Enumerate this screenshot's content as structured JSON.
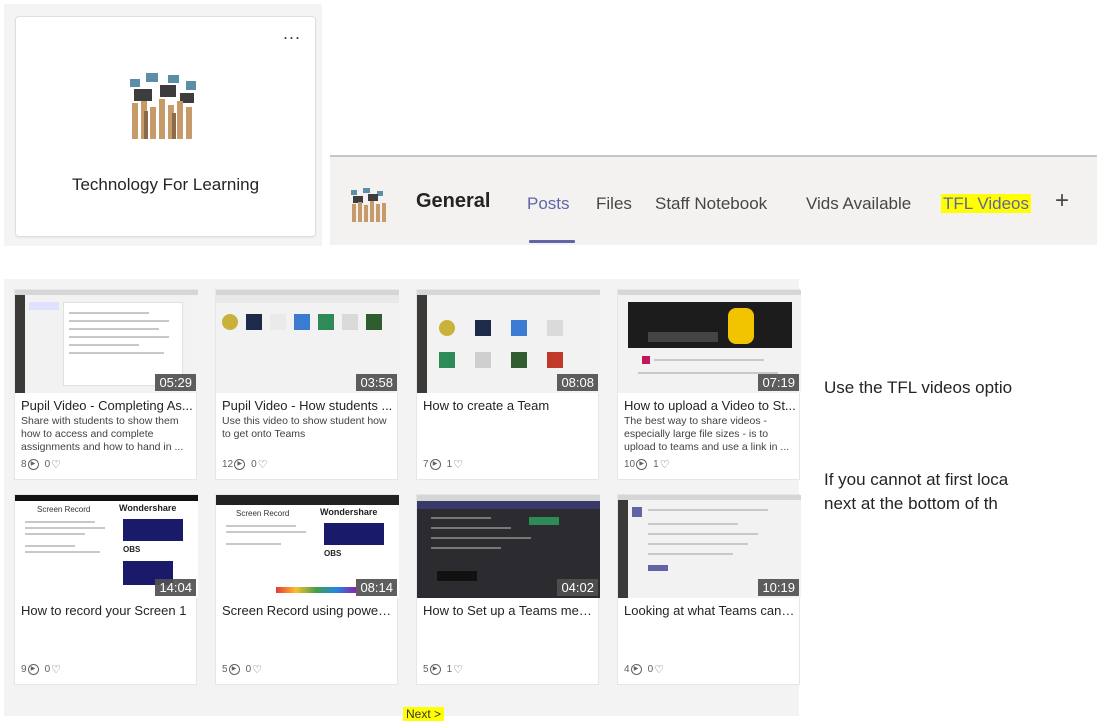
{
  "team": {
    "name": "Technology For Learning",
    "more": "..."
  },
  "channel": {
    "name": "General",
    "tabs": [
      "Posts",
      "Files",
      "Staff Notebook",
      "Vids Available",
      "TFL Videos"
    ],
    "add_tab": "+"
  },
  "videos": [
    {
      "title": "Pupil Video - Completing As...",
      "desc": "Share with students to show them how to access and complete assignments and how to hand in  ...",
      "duration": "05:29",
      "views": "8",
      "likes": "0"
    },
    {
      "title": "Pupil Video - How students ...",
      "desc": "Use this video to show student how to get onto Teams",
      "duration": "03:58",
      "views": "12",
      "likes": "0"
    },
    {
      "title": "How to create a Team",
      "desc": "",
      "duration": "08:08",
      "views": "7",
      "likes": "1"
    },
    {
      "title": "How to upload a Video to St...",
      "desc": "The best way to share videos - especially large file sizes - is to upload to teams and use a link in  ...",
      "duration": "07:19",
      "views": "10",
      "likes": "1"
    },
    {
      "title": "How to record your Screen 1",
      "desc": "",
      "duration": "14:04",
      "views": "9",
      "likes": "0"
    },
    {
      "title": "Screen Record using powerp...",
      "desc": "",
      "duration": "08:14",
      "views": "5",
      "likes": "0"
    },
    {
      "title": "How to Set up a Teams meet...",
      "desc": "",
      "duration": "04:02",
      "views": "5",
      "likes": "1"
    },
    {
      "title": "Looking at what Teams can do",
      "desc": "",
      "duration": "10:19",
      "views": "4",
      "likes": "0"
    }
  ],
  "slide": {
    "screen_record": "Screen Record",
    "wondershare": "Wondershare",
    "obs": "OBS"
  },
  "next_label": "Next >",
  "instructions": {
    "line1": "Use the TFL videos optio",
    "line2": "If you cannot at first loca",
    "line3": "next at the bottom of th"
  },
  "colors": {
    "accent": "#6264a7",
    "highlight": "#ffff00"
  }
}
